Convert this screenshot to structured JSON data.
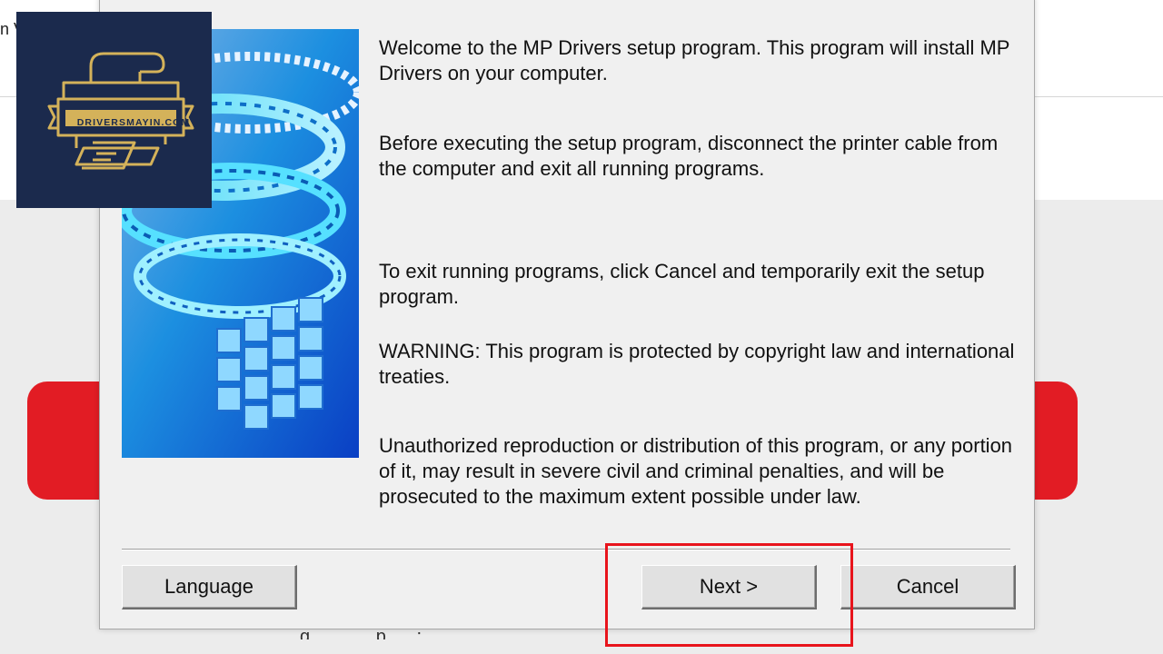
{
  "background": {
    "partial_text": "n V",
    "bottom_partial": "g . p ; ."
  },
  "logo": {
    "text": "DRIVERSMAYIN.COM",
    "colors": {
      "background": "#1b2a4d",
      "gold": "#d4b25a"
    }
  },
  "dialog": {
    "paragraphs": [
      "Welcome to the MP Drivers setup program. This program will install MP Drivers on your computer.",
      "Before executing the setup program, disconnect the printer cable from the computer and exit all running programs.",
      "To exit running programs, click Cancel and temporarily exit the setup program.",
      "WARNING: This program is protected by copyright law and international treaties.",
      "Unauthorized reproduction or distribution of this program, or any portion of it, may result in severe civil and criminal penalties, and will be prosecuted to the maximum extent possible under law."
    ],
    "buttons": {
      "language": "Language",
      "next": "Next >",
      "cancel": "Cancel"
    }
  },
  "colors": {
    "highlight": "#e8141c",
    "red_band": "#e21c24",
    "dialog_bg": "#f0f0f0"
  }
}
